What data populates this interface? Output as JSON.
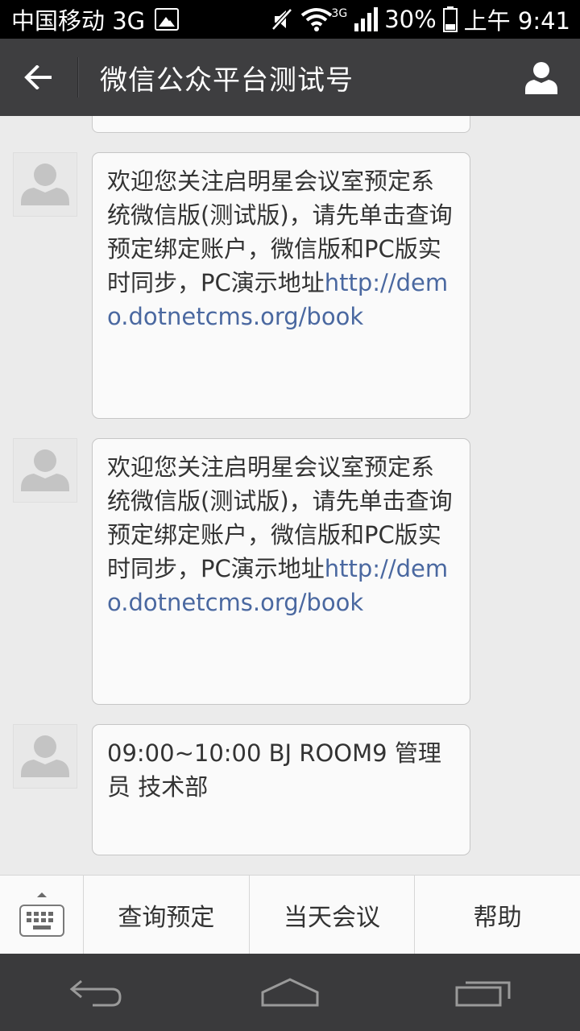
{
  "status_bar": {
    "carrier": "中国移动 3G",
    "network_small": "3G",
    "battery": "30%",
    "time": "上午 9:41"
  },
  "header": {
    "title": "微信公众平台测试号"
  },
  "messages": [
    {
      "text_prefix": "欢迎您关注启明星会议室预定系统微信版(测试版)，请先单击查询预定绑定账户，微信版和PC版实时同步，PC演示地址",
      "link": "http://demo.dotnetcms.org/book"
    },
    {
      "text_prefix": "欢迎您关注启明星会议室预定系统微信版(测试版)，请先单击查询预定绑定账户，微信版和PC版实时同步，PC演示地址",
      "link": "http://demo.dotnetcms.org/book"
    },
    {
      "text": "09:00~10:00 BJ ROOM9 管理员 技术部"
    }
  ],
  "menu": {
    "items": [
      {
        "label": "查询预定"
      },
      {
        "label": "当天会议"
      },
      {
        "label": "帮助"
      }
    ]
  },
  "icons": {
    "back": "back-arrow-icon",
    "profile": "person-icon",
    "keyboard": "keyboard-icon",
    "nav_back": "nav-back-icon",
    "nav_home": "nav-home-icon",
    "nav_recent": "nav-recent-icon"
  },
  "colors": {
    "title_bar": "#3e3e40",
    "link": "#4a68a0",
    "background": "#ebebeb"
  }
}
